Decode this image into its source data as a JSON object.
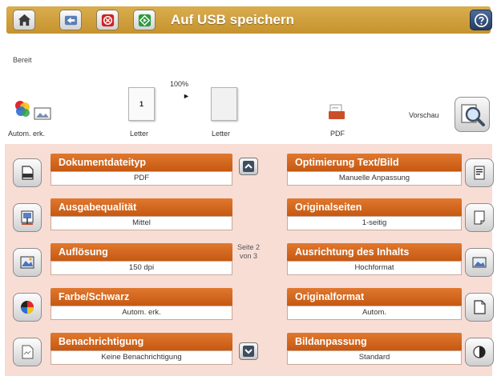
{
  "header": {
    "title": "Auf USB speichern",
    "colors": {
      "bar": "#c6932d",
      "help": "#233d63"
    }
  },
  "preview": {
    "status": "Bereit",
    "zoom": "100%",
    "color_mode_label": "Autom. erk.",
    "page1_number": "1",
    "page1_label": "Letter",
    "page2_label": "Letter",
    "file_type_label": "PDF",
    "preview_label": "Vorschau"
  },
  "options": {
    "left": [
      {
        "title": "Dokumentdateityp",
        "value": "PDF",
        "icon": "document-type-icon"
      },
      {
        "title": "Ausgabequalität",
        "value": "Mittel",
        "icon": "output-quality-icon"
      },
      {
        "title": "Auflösung",
        "value": "150 dpi",
        "icon": "resolution-icon"
      },
      {
        "title": "Farbe/Schwarz",
        "value": "Autom. erk.",
        "icon": "color-black-icon"
      },
      {
        "title": "Benachrichtigung",
        "value": "Keine Benachrichtigung",
        "icon": "notification-icon"
      }
    ],
    "right": [
      {
        "title": "Optimierung Text/Bild",
        "value": "Manuelle Anpassung",
        "icon": "optimize-text-image-icon"
      },
      {
        "title": "Originalseiten",
        "value": "1-seitig",
        "icon": "original-sides-icon"
      },
      {
        "title": "Ausrichtung des Inhalts",
        "value": "Hochformat",
        "icon": "content-orientation-icon"
      },
      {
        "title": "Originalformat",
        "value": "Autom.",
        "icon": "original-size-icon"
      },
      {
        "title": "Bildanpassung",
        "value": "Standard",
        "icon": "image-adjustment-icon"
      }
    ],
    "page_indicator_line1": "Seite 2",
    "page_indicator_line2": "von 3",
    "accent_color": "#c65912",
    "panel_color": "#f8ddd5"
  }
}
